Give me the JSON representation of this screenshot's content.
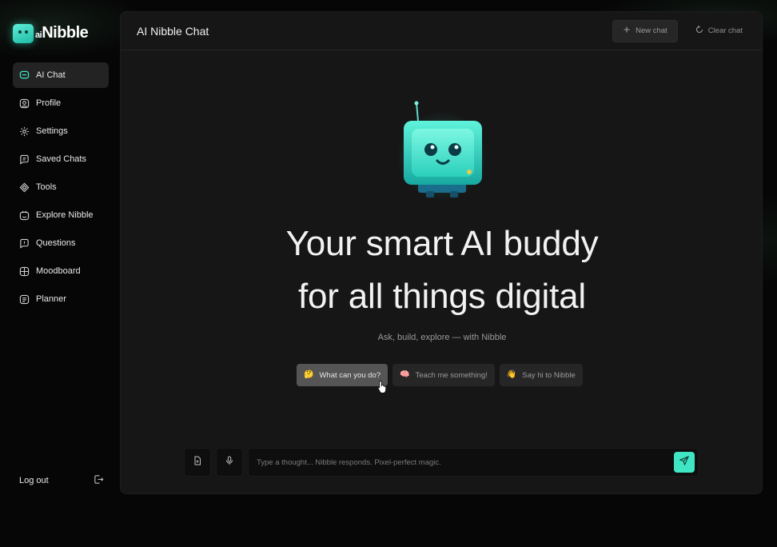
{
  "brand": {
    "logo_prefix": "ai",
    "logo_name": "Nibble"
  },
  "sidebar": {
    "items": [
      {
        "label": "AI Chat",
        "icon": "chat-bubble-icon",
        "active": true
      },
      {
        "label": "Profile",
        "icon": "user-icon",
        "active": false
      },
      {
        "label": "Settings",
        "icon": "gear-icon",
        "active": false
      },
      {
        "label": "Saved Chats",
        "icon": "saved-chats-icon",
        "active": false
      },
      {
        "label": "Tools",
        "icon": "tools-icon",
        "active": false
      },
      {
        "label": "Explore Nibble",
        "icon": "explore-icon",
        "active": false
      },
      {
        "label": "Questions",
        "icon": "question-icon",
        "active": false
      },
      {
        "label": "Moodboard",
        "icon": "grid-icon",
        "active": false
      },
      {
        "label": "Planner",
        "icon": "planner-icon",
        "active": false
      }
    ],
    "logout_label": "Log out"
  },
  "header": {
    "title": "AI Nibble Chat",
    "new_chat_label": "New chat",
    "clear_chat_label": "Clear chat"
  },
  "hero": {
    "heading_line1": "Your smart AI buddy",
    "heading_line2": "for all things digital",
    "subtitle": "Ask, build, explore — with Nibble"
  },
  "suggestions": [
    {
      "emoji": "🤔",
      "label": "What can you do?",
      "hovered": true
    },
    {
      "emoji": "🧠",
      "label": "Teach me something!",
      "hovered": false
    },
    {
      "emoji": "👋",
      "label": "Say hi to Nibble",
      "hovered": false
    }
  ],
  "composer": {
    "placeholder": "Type a thought... Nibble responds. Pixel-perfect magic.",
    "value": ""
  },
  "colors": {
    "accent": "#3fe6c3",
    "panel": "#161616",
    "background": "#050505",
    "active_nav": "#222322"
  }
}
